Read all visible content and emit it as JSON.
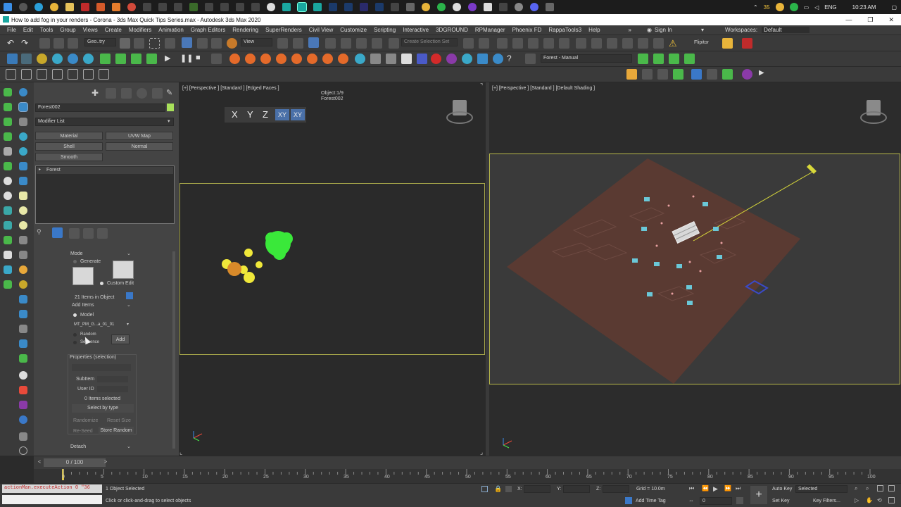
{
  "taskbar": {
    "tray_temp": "35",
    "tray_lang": "ENG",
    "tray_time": "10:23 AM"
  },
  "window": {
    "title": "How to add fog in your renders - Corona - 3ds Max Quick Tips Series.max - Autodesk 3ds Max 2020",
    "min": "—",
    "max": "❐",
    "close": "✕"
  },
  "menu": {
    "items": [
      "File",
      "Edit",
      "Tools",
      "Group",
      "Views",
      "Create",
      "Modifiers",
      "Animation",
      "Graph Editors",
      "Rendering",
      "SuperRenders",
      "Civil View",
      "Customize",
      "Scripting",
      "Interactive",
      "3DGROUND",
      "RPManager",
      "Phoenix FD",
      "RappaTools3",
      "Help"
    ],
    "more": "»",
    "sign_in": "Sign In",
    "workspaces_label": "Workspaces:",
    "workspaces_value": "Default"
  },
  "toolbar": {
    "geo_dropdown": "Geo..try",
    "view_dropdown": "View",
    "create_selection_set": "Create Selection Set",
    "forest_manual": "Forest - Manual",
    "flipitor": "Flipitor"
  },
  "command_panel": {
    "object_name": "Forest002",
    "modifier_list": "Modifier List",
    "buttons": {
      "material": "Material",
      "uvw_map": "UVW Map",
      "shell": "Shell",
      "normal": "Normal",
      "smooth": "Smooth"
    },
    "stack_item": "Forest",
    "mode": {
      "header": "Mode",
      "generate": "Generate",
      "custom_edit": "Custom Edit"
    },
    "items_in_object": "21 Items in Object",
    "add_items": {
      "header": "Add Items",
      "model": "Model",
      "model_value": "MT_PM_G...a_01_01",
      "random": "Random",
      "sequence": "Sequence",
      "add": "Add"
    },
    "properties": {
      "header": "Properties (selection)",
      "subitem": "SubItem",
      "user_id": "User ID",
      "items_selected": "0 Items selected",
      "select_by_type": "Select by type",
      "randomize": "Randomize",
      "reset_size": "Reset Size",
      "reseed": "Re-Seed",
      "store_random": "Store Random"
    },
    "detach": "Detach"
  },
  "viewports": {
    "left": {
      "label": "[+] [Perspective ] [Standard ] [Edged Faces ]",
      "object_count": "Object:1/9",
      "object_name": "Forest002",
      "axis_buttons": [
        "X",
        "Y",
        "Z",
        "XY",
        "XY"
      ]
    },
    "right": {
      "label": "[+] [Perspective ] [Standard ] [Default Shading ]"
    }
  },
  "timeline": {
    "frame_display": "0 / 100",
    "ticks": [
      "0",
      "5",
      "10",
      "15",
      "20",
      "25",
      "30",
      "35",
      "40",
      "45",
      "50",
      "55",
      "60",
      "65",
      "70",
      "75",
      "80",
      "85",
      "90",
      "95",
      "100"
    ],
    "prev": "<",
    "next": ">"
  },
  "status": {
    "maxscript": "actionMan.executeAction 0 \"36",
    "selection": "1 Object Selected",
    "prompt": "Click or click-and-drag to select objects",
    "x_label": "X:",
    "y_label": "Y:",
    "z_label": "Z:",
    "grid": "Grid = 10.0m",
    "add_time_tag": "Add Time Tag",
    "auto_key": "Auto Key",
    "set_key": "Set Key",
    "selected": "Selected",
    "key_filters": "Key Filters...",
    "frame": "0"
  }
}
